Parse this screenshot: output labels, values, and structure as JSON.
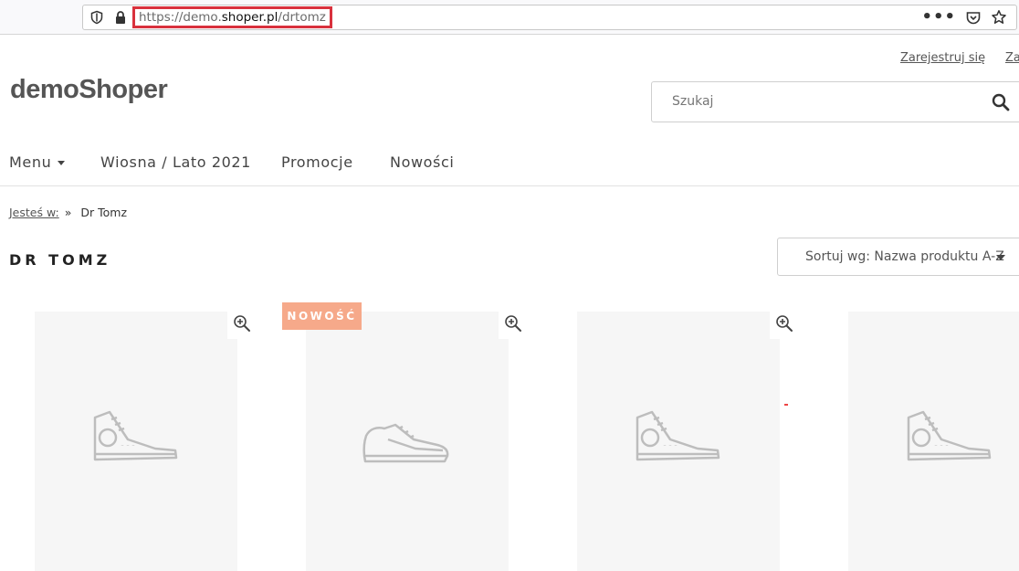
{
  "browser": {
    "url_prefix": "https://demo.",
    "url_host": "shoper.pl",
    "url_suffix": "/drtomz",
    "menu_dots": "•••"
  },
  "header": {
    "register_link": "Zarejestruj się",
    "login_link": "Za",
    "logo": "demoShoper",
    "search": {
      "placeholder": "Szukaj"
    }
  },
  "nav": {
    "items": [
      {
        "label": "Menu"
      },
      {
        "label": "Wiosna / Lato 2021"
      },
      {
        "label": "Promocje"
      },
      {
        "label": "Nowości"
      }
    ]
  },
  "breadcrumb": {
    "label": "Jesteś w:",
    "separator": "»",
    "current": "Dr Tomz"
  },
  "page": {
    "title": "DR TOMZ",
    "sort_label": "Sortuj wg: Nazwa produktu A-Z"
  },
  "products": [
    {
      "image": "high-top-sneaker-icon"
    },
    {
      "image": "running-shoe-icon",
      "badge": "NOWOŚĆ"
    },
    {
      "image": "high-top-sneaker-icon"
    },
    {
      "image": "high-top-sneaker-icon"
    }
  ],
  "colors": {
    "badge": "#f6a98a",
    "url_highlight": "#d9313d",
    "image_bg": "#f6f6f6"
  }
}
